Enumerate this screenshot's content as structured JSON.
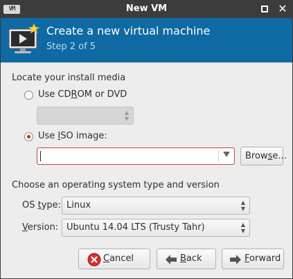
{
  "window": {
    "title": "New VM",
    "logo_text": "VM",
    "close_glyph": "✕"
  },
  "banner": {
    "heading": "Create a new virtual machine",
    "step": "Step 2 of 5",
    "icon": "vm-monitor-star-icon"
  },
  "media": {
    "section_label": "Locate your install media",
    "cdrom": {
      "label_pre": "Use CD",
      "label_mn": "R",
      "label_post": "OM or DVD",
      "selected": false,
      "combo_value": ""
    },
    "iso": {
      "label_pre": "Use ",
      "label_mn": "I",
      "label_post": "SO image:",
      "selected": true,
      "value": ""
    },
    "browse": {
      "label_pre": "Brow",
      "label_mn": "s",
      "label_post": "e..."
    }
  },
  "os": {
    "section_label": "Choose an operating system type and version",
    "type_label_pre": "OS ",
    "type_label_mn": "t",
    "type_label_post": "ype:",
    "type_value": "Linux",
    "version_label_pre": "",
    "version_label_mn": "V",
    "version_label_post": "ersion:",
    "version_value": "Ubuntu 14.04 LTS (Trusty Tahr)"
  },
  "buttons": {
    "cancel": {
      "pre": "",
      "mn": "C",
      "post": "ancel"
    },
    "back": {
      "pre": "",
      "mn": "B",
      "post": "ack"
    },
    "forward": {
      "pre": "",
      "mn": "F",
      "post": "orward"
    }
  },
  "colors": {
    "banner": "#0f6aa3",
    "titlebar": "#3c3c3c",
    "radio_selected": "#c62828",
    "entry_error_border": "#c94040"
  }
}
